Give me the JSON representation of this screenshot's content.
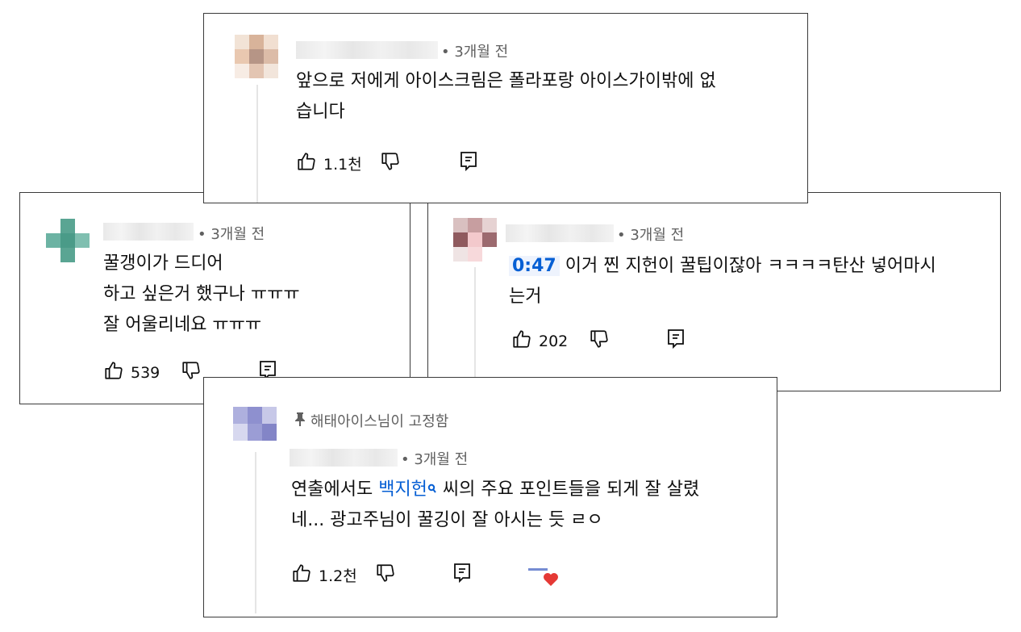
{
  "comments": [
    {
      "time": "• 3개월 전",
      "lines": [
        "앞으로 저에게 아이스크림은 폴라포랑 아이스가이밖에 없",
        "습니다"
      ],
      "likes": "1.1천"
    },
    {
      "time": "• 3개월 전",
      "lines": [
        "꿀갱이가 드디어",
        "하고 싶은거 했구나 ㅠㅠㅠ",
        "잘 어울리네요 ㅠㅠㅠ"
      ],
      "likes": "539"
    },
    {
      "time": "• 3개월 전",
      "timestamp_link": "0:47",
      "line1_rest": "이거 찐 지헌이 꿀팁이잖아 ㅋㅋㅋㅋ탄산 넣어마시",
      "line2": "는거",
      "likes": "202"
    },
    {
      "pinned_label": "해태아이스님이 고정함",
      "time": "• 3개월 전",
      "line1_pre": "연출에서도 ",
      "mention": "백지헌",
      "line1_post": " 씨의 주요 포인트들을 되게 잘 살렸",
      "line2": "네... 광고주님이 꿀깅이 잘 아시는 듯 ㄹㅇ",
      "likes": "1.2천"
    }
  ],
  "icons": {
    "like": "thumbs-up-icon",
    "dislike": "thumbs-down-icon",
    "reply": "reply-icon",
    "pin": "pin-icon",
    "heart": "creator-heart-icon"
  },
  "colors": {
    "link": "#065fd4",
    "meta": "#606060",
    "heart": "#e53935",
    "border": "#3a3a3a"
  }
}
